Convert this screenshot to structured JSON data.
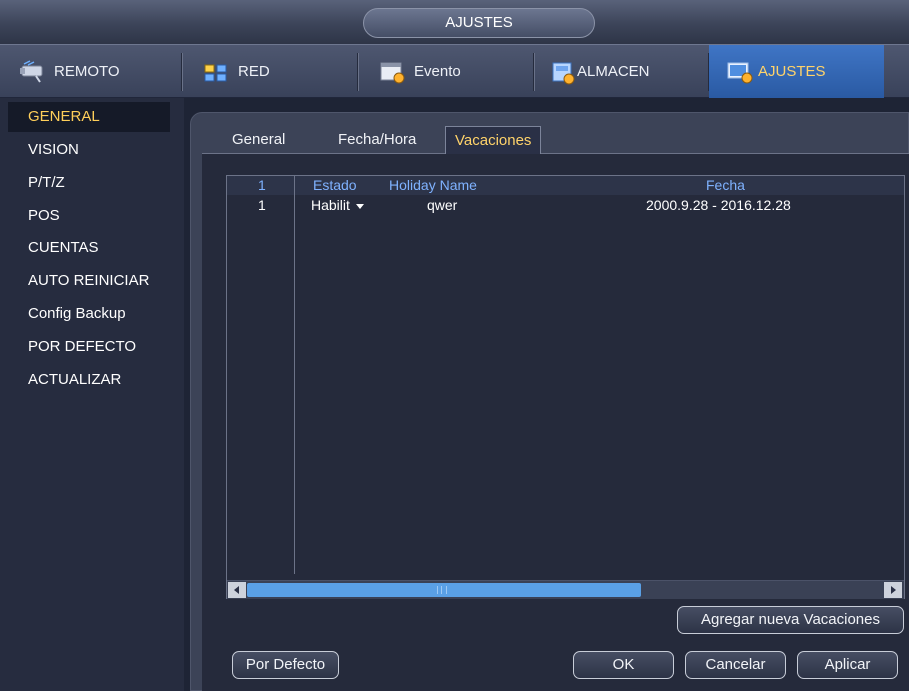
{
  "window": {
    "title": "AJUSTES"
  },
  "main_tabs": [
    {
      "label": "REMOTO",
      "icon": "camera-icon"
    },
    {
      "label": "RED",
      "icon": "network-icon"
    },
    {
      "label": "Evento",
      "icon": "event-icon"
    },
    {
      "label": "ALMACEN",
      "icon": "storage-icon"
    },
    {
      "label": "AJUSTES",
      "icon": "settings-icon",
      "active": true
    }
  ],
  "sidebar": {
    "items": [
      {
        "label": "GENERAL",
        "active": true
      },
      {
        "label": "VISION"
      },
      {
        "label": "P/T/Z"
      },
      {
        "label": "POS"
      },
      {
        "label": "CUENTAS"
      },
      {
        "label": "AUTO REINICIAR"
      },
      {
        "label": "Config Backup"
      },
      {
        "label": "POR DEFECTO"
      },
      {
        "label": "ACTUALIZAR"
      }
    ]
  },
  "sub_tabs": [
    {
      "label": "General"
    },
    {
      "label": "Fecha/Hora"
    },
    {
      "label": "Vacaciones",
      "active": true
    }
  ],
  "table": {
    "headers": {
      "index": "1",
      "estado": "Estado",
      "name": "Holiday Name",
      "fecha": "Fecha"
    },
    "rows": [
      {
        "index": "1",
        "estado": "Habilit",
        "name": "qwer",
        "fecha": "2000.9.28 - 2016.12.28"
      }
    ]
  },
  "buttons": {
    "add": "Agregar nueva Vacaciones",
    "default": "Por Defecto",
    "ok": "OK",
    "cancel": "Cancelar",
    "apply": "Aplicar"
  },
  "colors": {
    "accent_text": "#ffd36a",
    "header_text": "#7fb2ff",
    "active_tab": "#2a5aa3",
    "scroll_thumb": "#5aa0e6"
  }
}
